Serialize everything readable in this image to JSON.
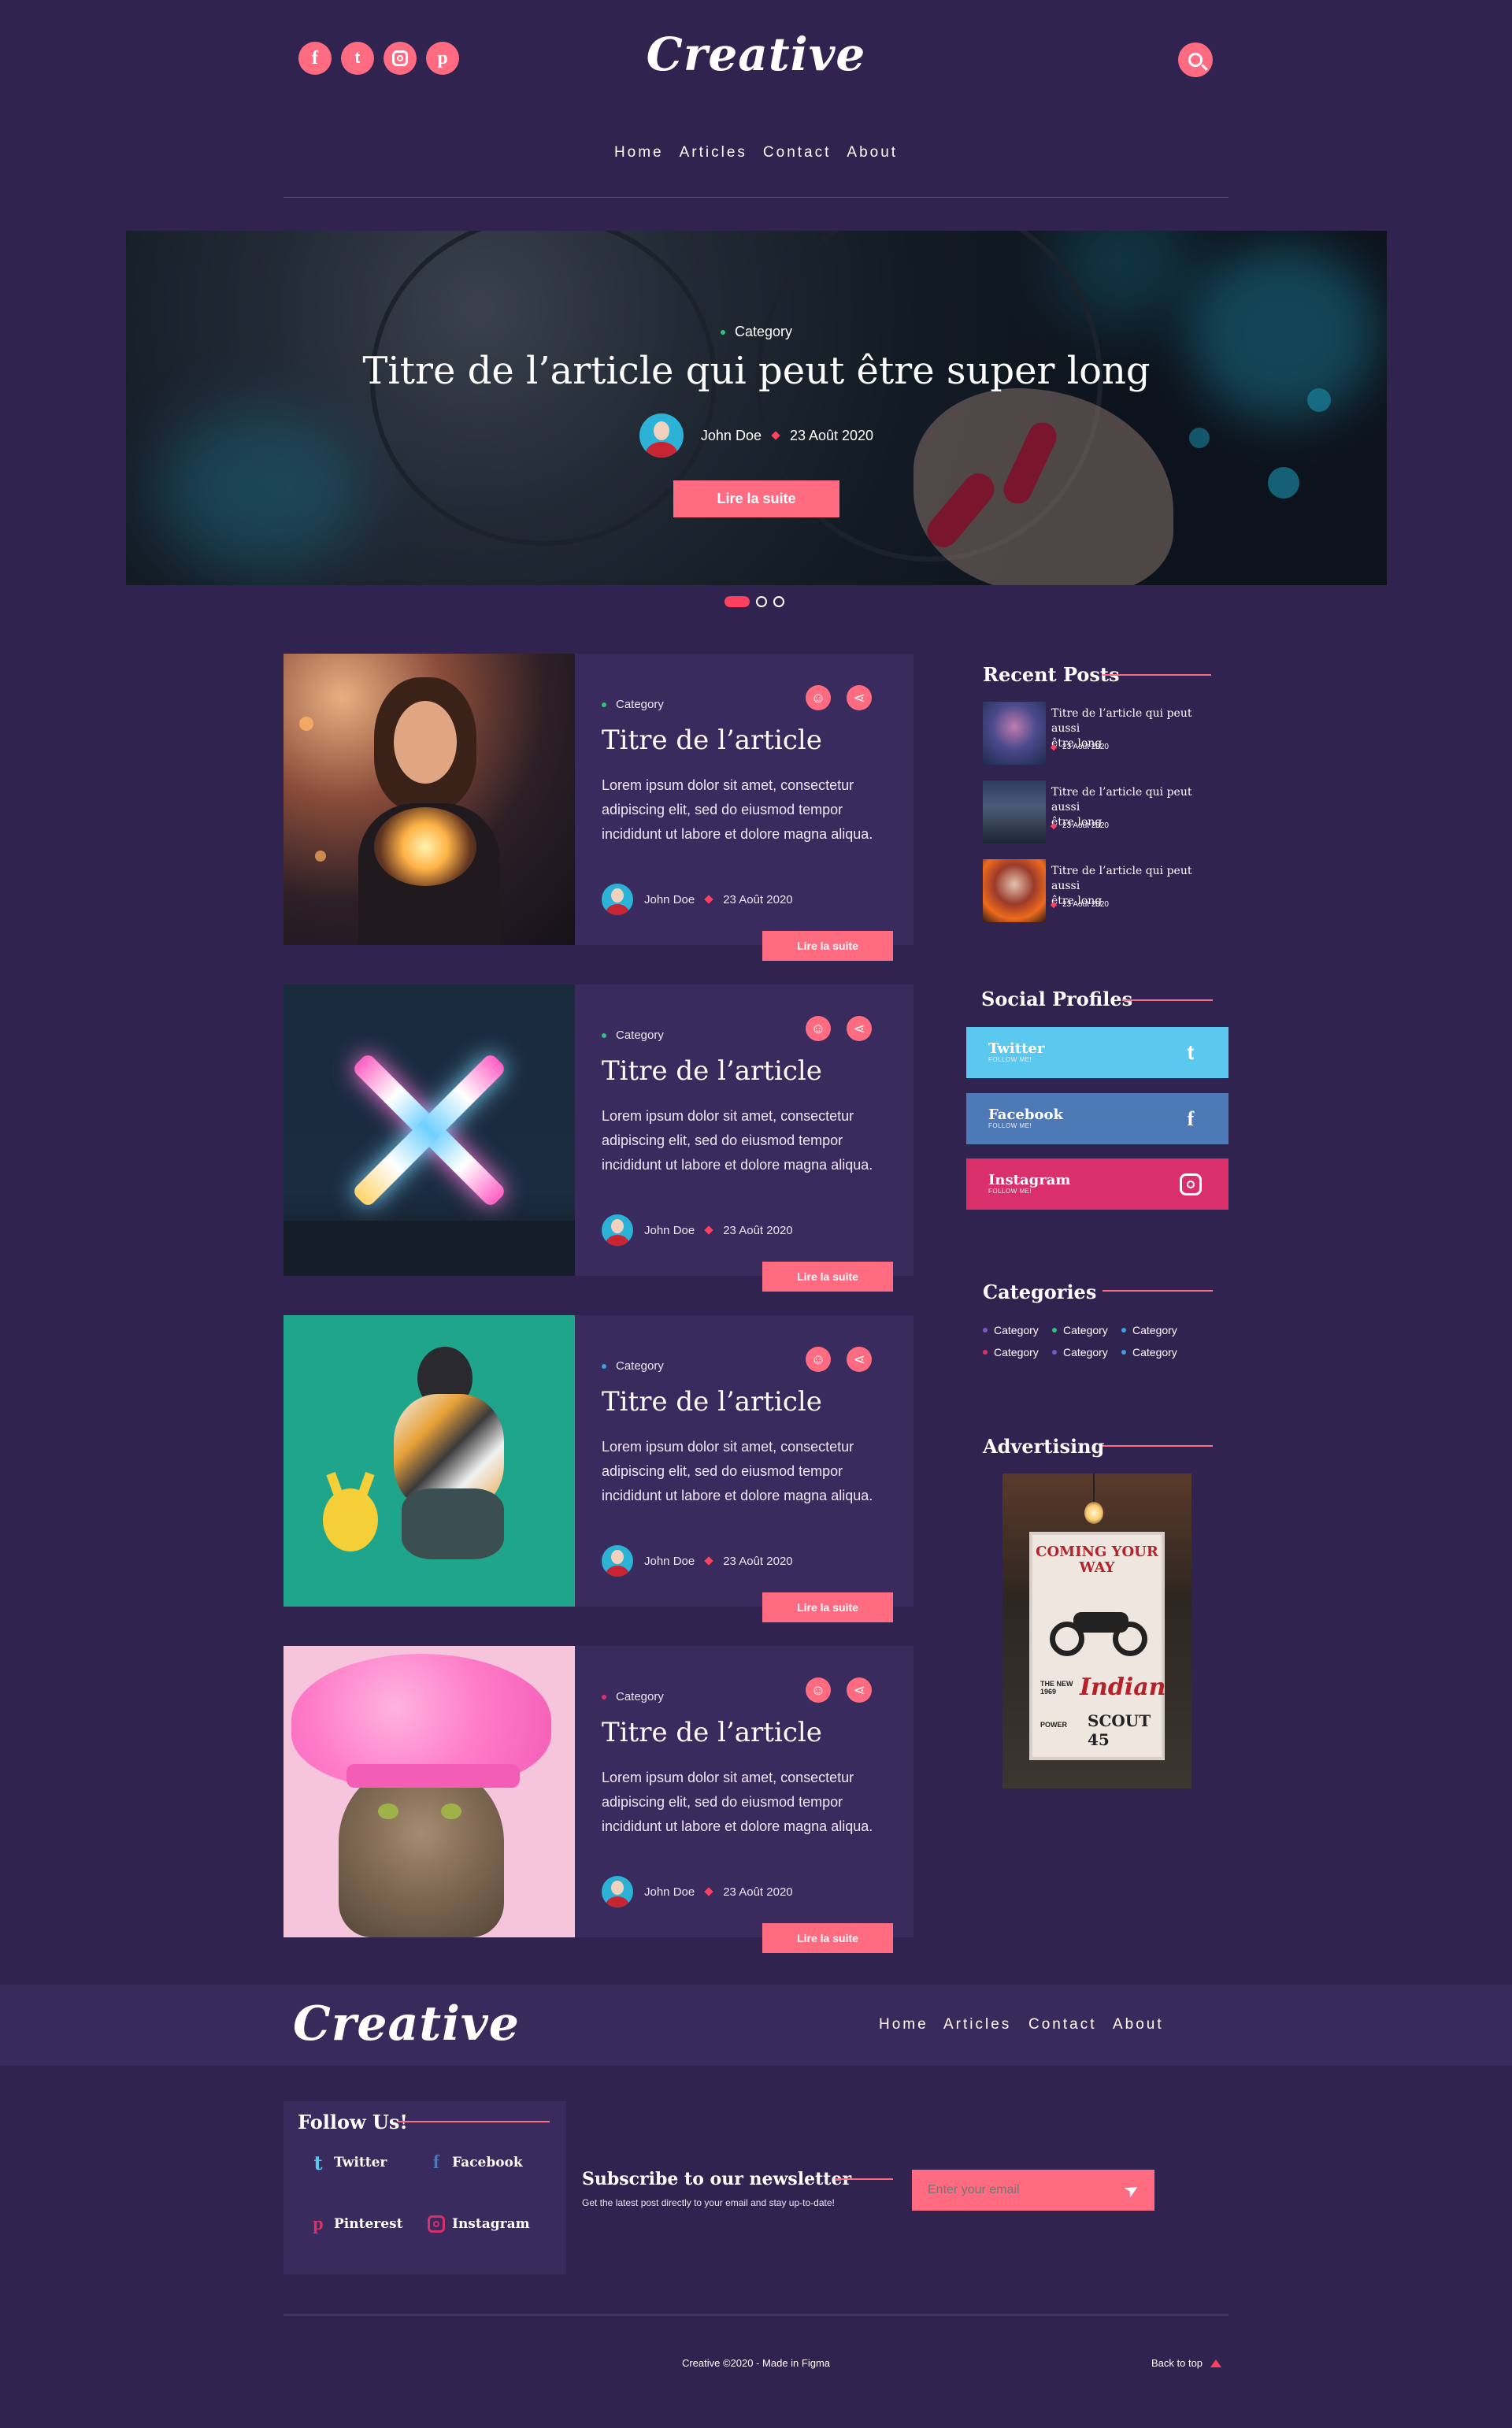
{
  "header": {
    "brand": "Creative",
    "social_icons": [
      "facebook-icon",
      "twitter-icon",
      "instagram-icon",
      "pinterest-icon"
    ],
    "search_icon": "search-icon",
    "nav": [
      "Home",
      "Articles",
      "Contact",
      "About"
    ]
  },
  "hero": {
    "category": "Category",
    "title": "Titre de l’article qui peut être super long",
    "author": "John Doe",
    "date": "23 Août 2020",
    "button": "Lire la suite",
    "slides": 3,
    "active_slide": 1
  },
  "articles": [
    {
      "category": "Category",
      "category_color": "#2ec27e",
      "title": "Titre de l’article",
      "excerpt": "Lorem ipsum dolor sit amet, consectetur adipiscing elit, sed do eiusmod tempor incididunt ut labore et dolore magna aliqua.",
      "author": "John Doe",
      "date": "23 Août 2020",
      "button": "Lire la suite"
    },
    {
      "category": "Category",
      "category_color": "#2ec27e",
      "title": "Titre de l’article",
      "excerpt": "Lorem ipsum dolor sit amet, consectetur adipiscing elit, sed do eiusmod tempor incididunt ut labore et dolore magna aliqua.",
      "author": "John Doe",
      "date": "23 Août 2020",
      "button": "Lire la suite"
    },
    {
      "category": "Category",
      "category_color": "#3aa0e0",
      "title": "Titre de l’article",
      "excerpt": "Lorem ipsum dolor sit amet, consectetur adipiscing elit, sed do eiusmod tempor incididunt ut labore et dolore magna aliqua.",
      "author": "John Doe",
      "date": "23 Août 2020",
      "button": "Lire la suite"
    },
    {
      "category": "Category",
      "category_color": "#e0306a",
      "title": "Titre de l’article",
      "excerpt": "Lorem ipsum dolor sit amet, consectetur adipiscing elit, sed do eiusmod tempor incididunt ut labore et dolore magna aliqua.",
      "author": "John Doe",
      "date": "23 Août 2020",
      "button": "Lire la suite"
    }
  ],
  "sidebar": {
    "recent_title": "Recent Posts",
    "recent": [
      {
        "line1": "Titre de l’article qui peut aussi",
        "line2": "être long",
        "date": "23 Août 2020"
      },
      {
        "line1": "Titre de l’article qui peut aussi",
        "line2": "être long",
        "date": "23 Août 2020"
      },
      {
        "line1": "Titre de l’article qui peut aussi",
        "line2": "être long",
        "date": "23 Août 2020"
      }
    ],
    "social_title": "Social Profiles",
    "social": [
      {
        "name": "Twitter",
        "sub": "FOLLOW ME!",
        "color": "#5bc8ef",
        "icon": "twitter-icon"
      },
      {
        "name": "Facebook",
        "sub": "FOLLOW ME!",
        "color": "#4d7ab6",
        "icon": "facebook-icon"
      },
      {
        "name": "Instagram",
        "sub": "FOLLOW ME!",
        "color": "#d92f6b",
        "icon": "instagram-icon"
      }
    ],
    "categories_title": "Categories",
    "categories": [
      {
        "label": "Category",
        "color": "#7b58c2"
      },
      {
        "label": "Category",
        "color": "#2ec27e"
      },
      {
        "label": "Category",
        "color": "#3aa0e0"
      },
      {
        "label": "Category",
        "color": "#e0306a"
      },
      {
        "label": "Category",
        "color": "#7b58c2"
      },
      {
        "label": "Category",
        "color": "#3aa0e0"
      }
    ],
    "advertising_title": "Advertising",
    "ad": {
      "line1": "COMING YOUR WAY",
      "line2": "THE NEW 1969",
      "line3": "Indian",
      "line4": "SCOUT 45",
      "line5": "POWER"
    }
  },
  "footer": {
    "brand": "Creative",
    "nav": [
      "Home",
      "Articles",
      "Contact",
      "About"
    ],
    "follow_title": "Follow Us!",
    "follow": [
      {
        "label": "Twitter",
        "icon": "twitter-icon",
        "color": "#5bc8ef"
      },
      {
        "label": "Facebook",
        "icon": "facebook-icon",
        "color": "#4d7ab6"
      },
      {
        "label": "Pinterest",
        "icon": "pinterest-icon",
        "color": "#e0306a"
      },
      {
        "label": "Instagram",
        "icon": "instagram-icon",
        "color": "#d92f6b"
      }
    ],
    "newsletter_title": "Subscribe to our newsletter",
    "newsletter_text": "Get the latest post directly to your email and stay up-to-date!",
    "email_placeholder": "Enter your email",
    "copyright": "Creative ©2020 - Made in Figma",
    "back_to_top": "Back to top"
  },
  "colors": {
    "background": "#30234f",
    "panel": "#3a2b5e",
    "accent": "#ff6b81"
  }
}
